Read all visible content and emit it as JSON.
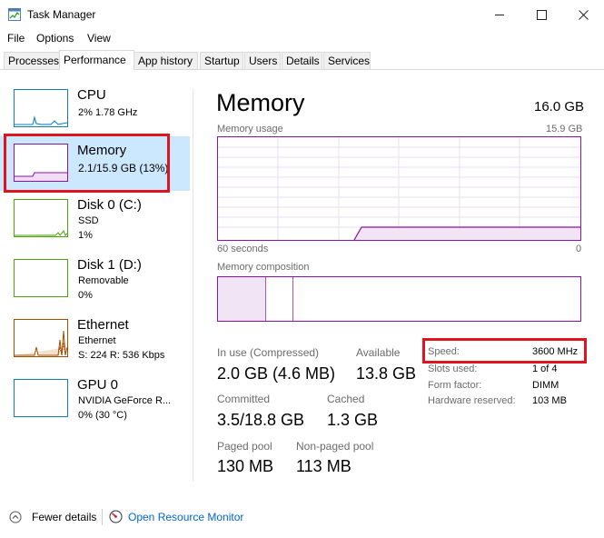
{
  "window": {
    "title": "Task Manager",
    "minimize_glyph": "—",
    "maximize_glyph": "☐",
    "close_glyph": "✕"
  },
  "menu": [
    "File",
    "Options",
    "View"
  ],
  "tabs": [
    "Processes",
    "Performance",
    "App history",
    "Startup",
    "Users",
    "Details",
    "Services"
  ],
  "active_tab": "Performance",
  "sidebar": [
    {
      "title": "CPU",
      "lines": [
        "2%  1.78 GHz"
      ],
      "color": "#117dbb"
    },
    {
      "title": "Memory",
      "lines": [
        "2.1/15.9 GB (13%)"
      ],
      "color": "#8b12ae"
    },
    {
      "title": "Disk 0 (C:)",
      "lines": [
        "SSD",
        "1%"
      ],
      "color": "#4da60c"
    },
    {
      "title": "Disk 1 (D:)",
      "lines": [
        "Removable",
        "0%"
      ],
      "color": "#4da60c"
    },
    {
      "title": "Ethernet",
      "lines": [
        "Ethernet",
        "S: 224  R: 536 Kbps"
      ],
      "color": "#a74f01"
    },
    {
      "title": "GPU 0",
      "lines": [
        "NVIDIA GeForce R...",
        "0% (30 °C)"
      ],
      "color": "#117dbb"
    }
  ],
  "main": {
    "title": "Memory",
    "total": "16.0 GB",
    "usage_label": "Memory usage",
    "usage_max": "15.9 GB",
    "time_label": "60 seconds",
    "time_zero": "0",
    "composition_label": "Memory composition",
    "stats": {
      "in_use_label": "In use (Compressed)",
      "in_use_value": "2.0 GB (4.6 MB)",
      "available_label": "Available",
      "available_value": "13.8 GB",
      "committed_label": "Committed",
      "committed_value": "3.5/18.8 GB",
      "cached_label": "Cached",
      "cached_value": "1.3 GB",
      "paged_label": "Paged pool",
      "paged_value": "130 MB",
      "nonpaged_label": "Non-paged pool",
      "nonpaged_value": "113 MB"
    },
    "specs": {
      "speed_label": "Speed:",
      "speed_value": "3600 MHz",
      "slots_label": "Slots used:",
      "slots_value": "1 of 4",
      "form_label": "Form factor:",
      "form_value": "DIMM",
      "hw_label": "Hardware reserved:",
      "hw_value": "103 MB"
    }
  },
  "footer": {
    "fewer_details": "Fewer details",
    "open_monitor": "Open Resource Monitor"
  },
  "colors": {
    "memory_accent": "#8b12ae",
    "selection": "#cce8ff",
    "highlight": "#e0141e",
    "link": "#0066cc"
  }
}
